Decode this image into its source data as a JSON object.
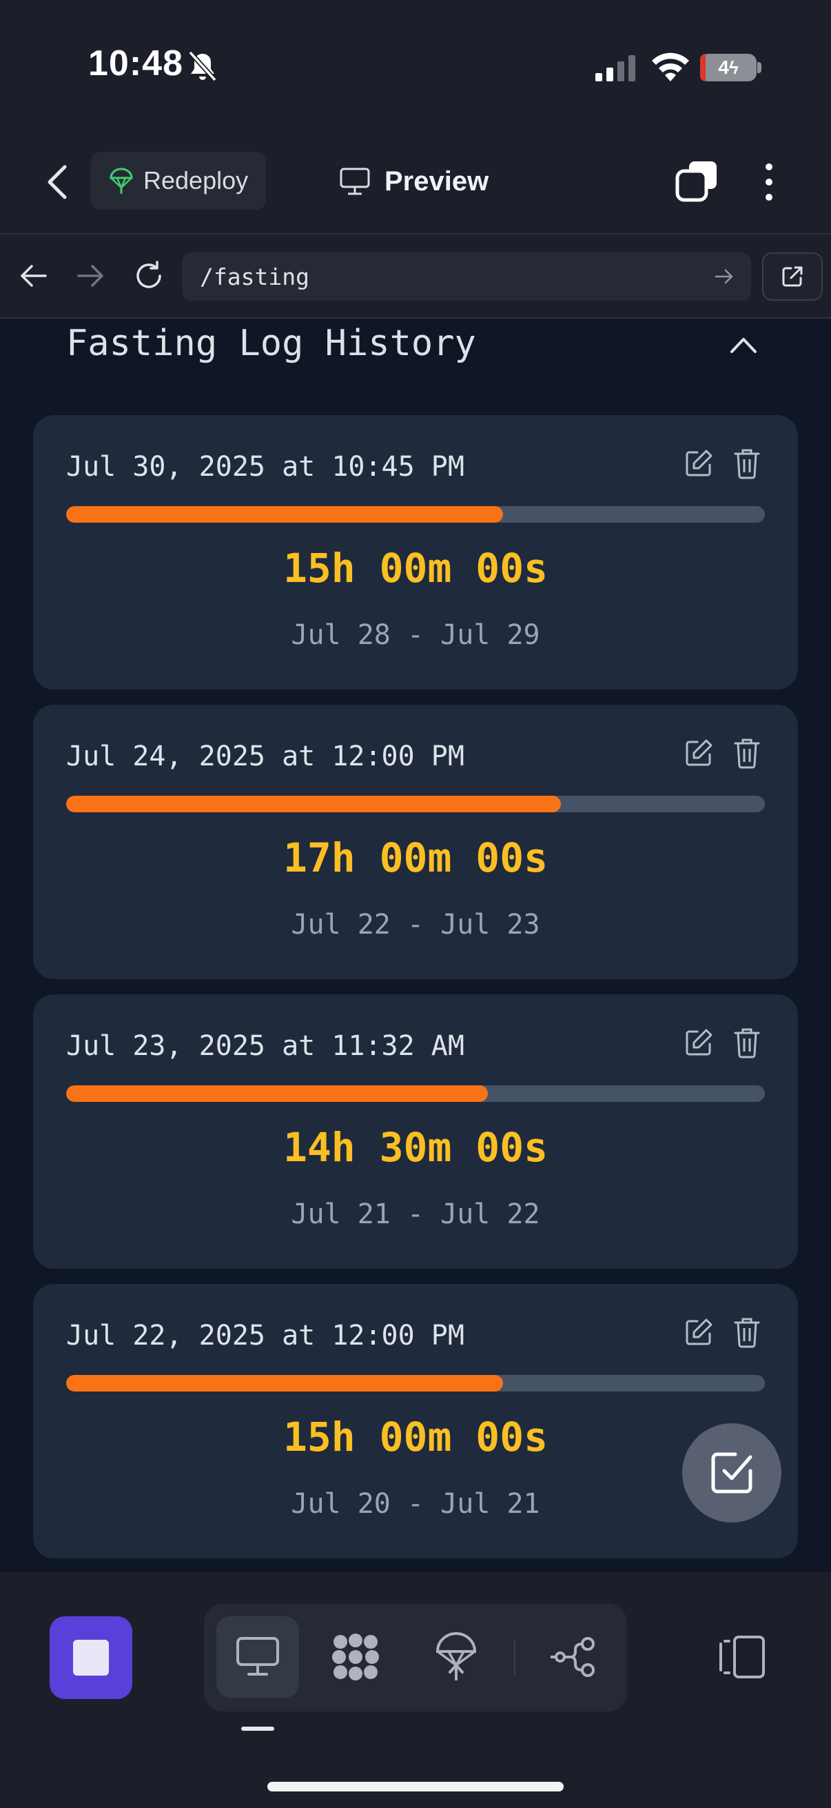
{
  "status_bar": {
    "time": "10:48",
    "battery": "4"
  },
  "header": {
    "redeploy_label": "Redeploy",
    "preview_label": "Preview"
  },
  "browser": {
    "url": "/fasting"
  },
  "section": {
    "title": "Fasting Log History"
  },
  "logs": [
    {
      "date": "Jul 30, 2025 at 10:45 PM",
      "duration": "15h 00m 00s",
      "range": "Jul 28 - Jul 29",
      "progress": 0.625
    },
    {
      "date": "Jul 24, 2025 at 12:00 PM",
      "duration": "17h 00m 00s",
      "range": "Jul 22 - Jul 23",
      "progress": 0.708
    },
    {
      "date": "Jul 23, 2025 at 11:32 AM",
      "duration": "14h 30m 00s",
      "range": "Jul 21 - Jul 22",
      "progress": 0.604
    },
    {
      "date": "Jul 22, 2025 at 12:00 PM",
      "duration": "15h 00m 00s",
      "range": "Jul 20 - Jul 21",
      "progress": 0.625
    }
  ],
  "icons": {
    "back": "chevron-left-icon",
    "redeploy": "parachute-icon",
    "preview": "monitor-icon",
    "window": "stacked-windows-icon",
    "more": "more-vertical-icon",
    "nav_back": "arrow-left-icon",
    "nav_forward": "arrow-right-icon",
    "reload": "reload-icon",
    "go": "arrow-right-icon",
    "open_external": "external-link-icon",
    "collapse": "chevron-up-icon",
    "edit": "edit-icon",
    "delete": "trash-icon",
    "fab": "check-square-icon",
    "stop": "stop-icon",
    "desktop": "monitor-icon",
    "apps": "grid-blob-icon",
    "deploy": "parachute-icon",
    "graph": "share-nodes-icon",
    "side_panel": "side-panel-icon"
  },
  "colors": {
    "accent_orange": "#f97316",
    "duration_yellow": "#fbbf24",
    "stop_purple": "#5b3fd9"
  }
}
